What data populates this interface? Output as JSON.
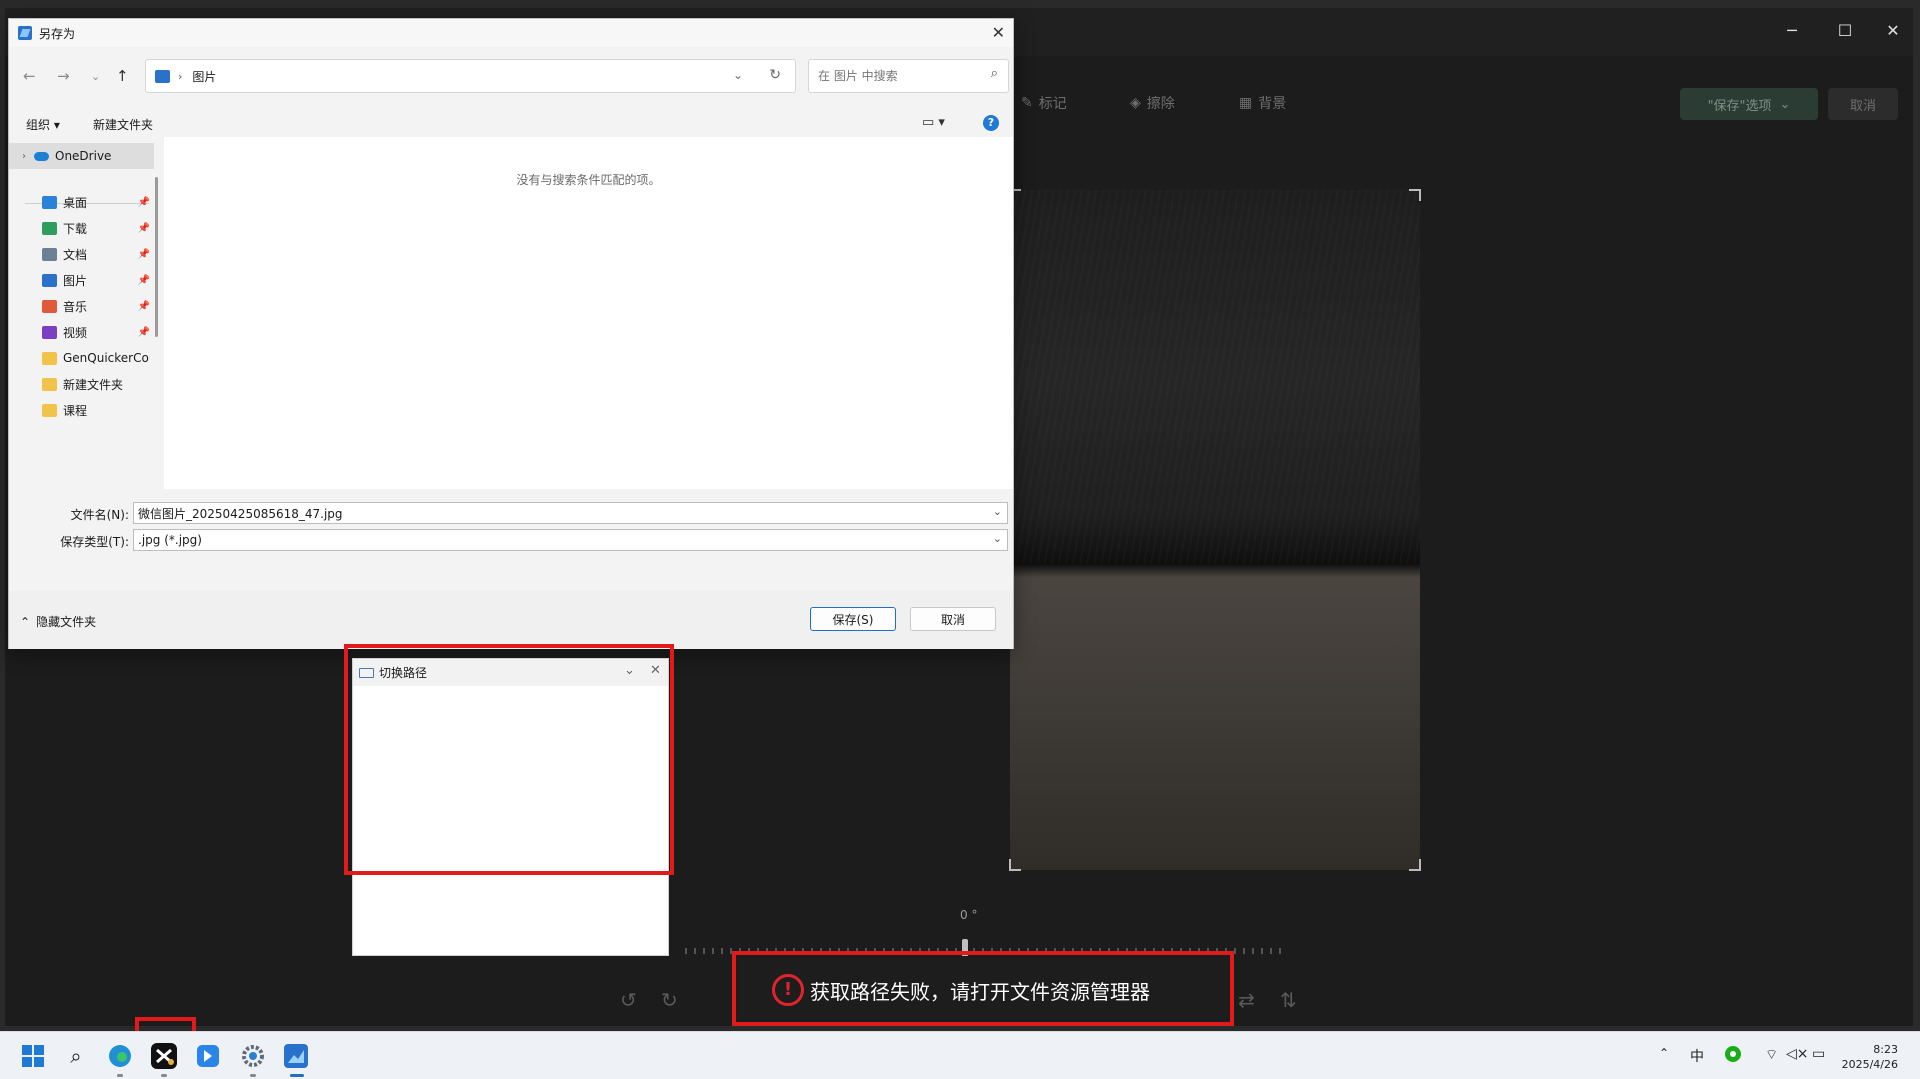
{
  "editor": {
    "tools": {
      "mark": "标记",
      "erase": "擦除",
      "background": "背景"
    },
    "save_options_label": "\"保存\"选项",
    "cancel_label": "取消",
    "angle_value": "0 °",
    "window_controls": {
      "minimize": "─",
      "maximize": "☐",
      "close": "✕"
    }
  },
  "dialog": {
    "title": "另存为",
    "address": {
      "current_folder": "图片"
    },
    "search": {
      "placeholder": "在 图片 中搜索"
    },
    "commands": {
      "organize": "组织 ▾",
      "new_folder": "新建文件夹"
    },
    "nav": {
      "onedrive": "OneDrive",
      "items": [
        {
          "label": "桌面",
          "icon": "desktop-icon",
          "color": "#2b82d9"
        },
        {
          "label": "下载",
          "icon": "download-icon",
          "color": "#2f9d5d"
        },
        {
          "label": "文档",
          "icon": "document-icon",
          "color": "#6d7f95"
        },
        {
          "label": "图片",
          "icon": "pictures-icon",
          "color": "#2a71c9"
        },
        {
          "label": "音乐",
          "icon": "music-icon",
          "color": "#e0593b"
        },
        {
          "label": "视频",
          "icon": "video-icon",
          "color": "#7b3fc4"
        },
        {
          "label": "GenQuickerCo",
          "icon": "folder-icon",
          "color": "#f2c34b"
        },
        {
          "label": "新建文件夹",
          "icon": "folder-icon",
          "color": "#f2c34b"
        },
        {
          "label": "课程",
          "icon": "folder-icon",
          "color": "#f2c34b"
        }
      ]
    },
    "empty_message": "没有与搜索条件匹配的项。",
    "filename": {
      "label": "文件名(N):",
      "value": "微信图片_20250425085618_47.jpg"
    },
    "filetype": {
      "label": "保存类型(T):",
      "value": ".jpg (*.jpg)"
    },
    "hide_folders": "隐藏文件夹",
    "save_button": "保存(S)",
    "cancel_button": "取消"
  },
  "path_window": {
    "title": "切换路径"
  },
  "toast": {
    "message": "获取路径失败，请打开文件资源管理器",
    "icon": "!"
  },
  "taskbar": {
    "tray": {
      "ime": "中"
    },
    "clock": {
      "time": "8:23",
      "date": "2025/4/26"
    }
  },
  "colors": {
    "accent": "#1e70c6",
    "annotation": "#e11b1b",
    "error": "#e3232b"
  }
}
